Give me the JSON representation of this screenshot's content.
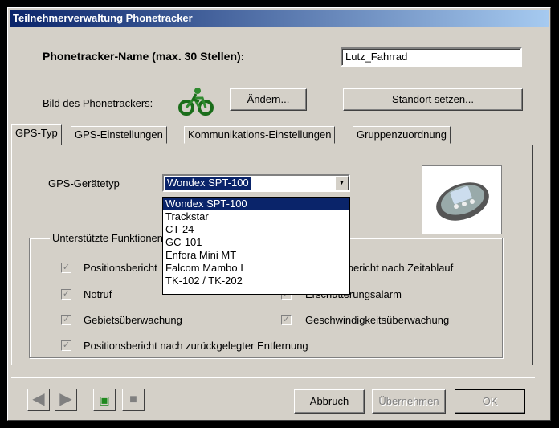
{
  "window": {
    "title": "Teilnehmerverwaltung Phonetracker"
  },
  "name_row": {
    "label": "Phonetracker-Name (max. 30 Stellen):",
    "value": "Lutz_Fahrrad"
  },
  "image_row": {
    "label": "Bild des Phonetrackers:",
    "icon": "bicycle-icon",
    "change_button": "Ändern...",
    "location_button": "Standort setzen..."
  },
  "tabs": [
    {
      "label": "GPS-Typ",
      "active": true
    },
    {
      "label": "GPS-Einstellungen",
      "active": false
    },
    {
      "label": "Kommunikations-Einstellungen",
      "active": false
    },
    {
      "label": "Gruppenzuordnung",
      "active": false
    }
  ],
  "gps": {
    "device_label": "GPS-Gerätetyp",
    "selected": "Wondex SPT-100",
    "options": [
      "Wondex SPT-100",
      "Trackstar",
      "CT-24",
      "GC-101",
      "Enfora Mini MT",
      "Falcom Mambo I",
      "TK-102 / TK-202"
    ]
  },
  "functions": {
    "title": "Unterstützte Funktionen",
    "items": [
      {
        "label": "Positionsbericht",
        "checked": true
      },
      {
        "label": "Positionsbericht nach Zeitablauf",
        "checked": true
      },
      {
        "label": "Notruf",
        "checked": true
      },
      {
        "label": "Erschütterungsalarm",
        "checked": true
      },
      {
        "label": "Gebietsüberwachung",
        "checked": true
      },
      {
        "label": "Geschwindigkeitsüberwachung",
        "checked": true
      },
      {
        "label": "Positionsbericht nach zurückgelegter Entfernung",
        "checked": true
      }
    ]
  },
  "footer": {
    "cancel": "Abbruch",
    "apply": "Übernehmen",
    "ok": "OK"
  },
  "colors": {
    "titlebar": "#0a246a",
    "face": "#d4d0c8",
    "selection": "#0a246a"
  }
}
